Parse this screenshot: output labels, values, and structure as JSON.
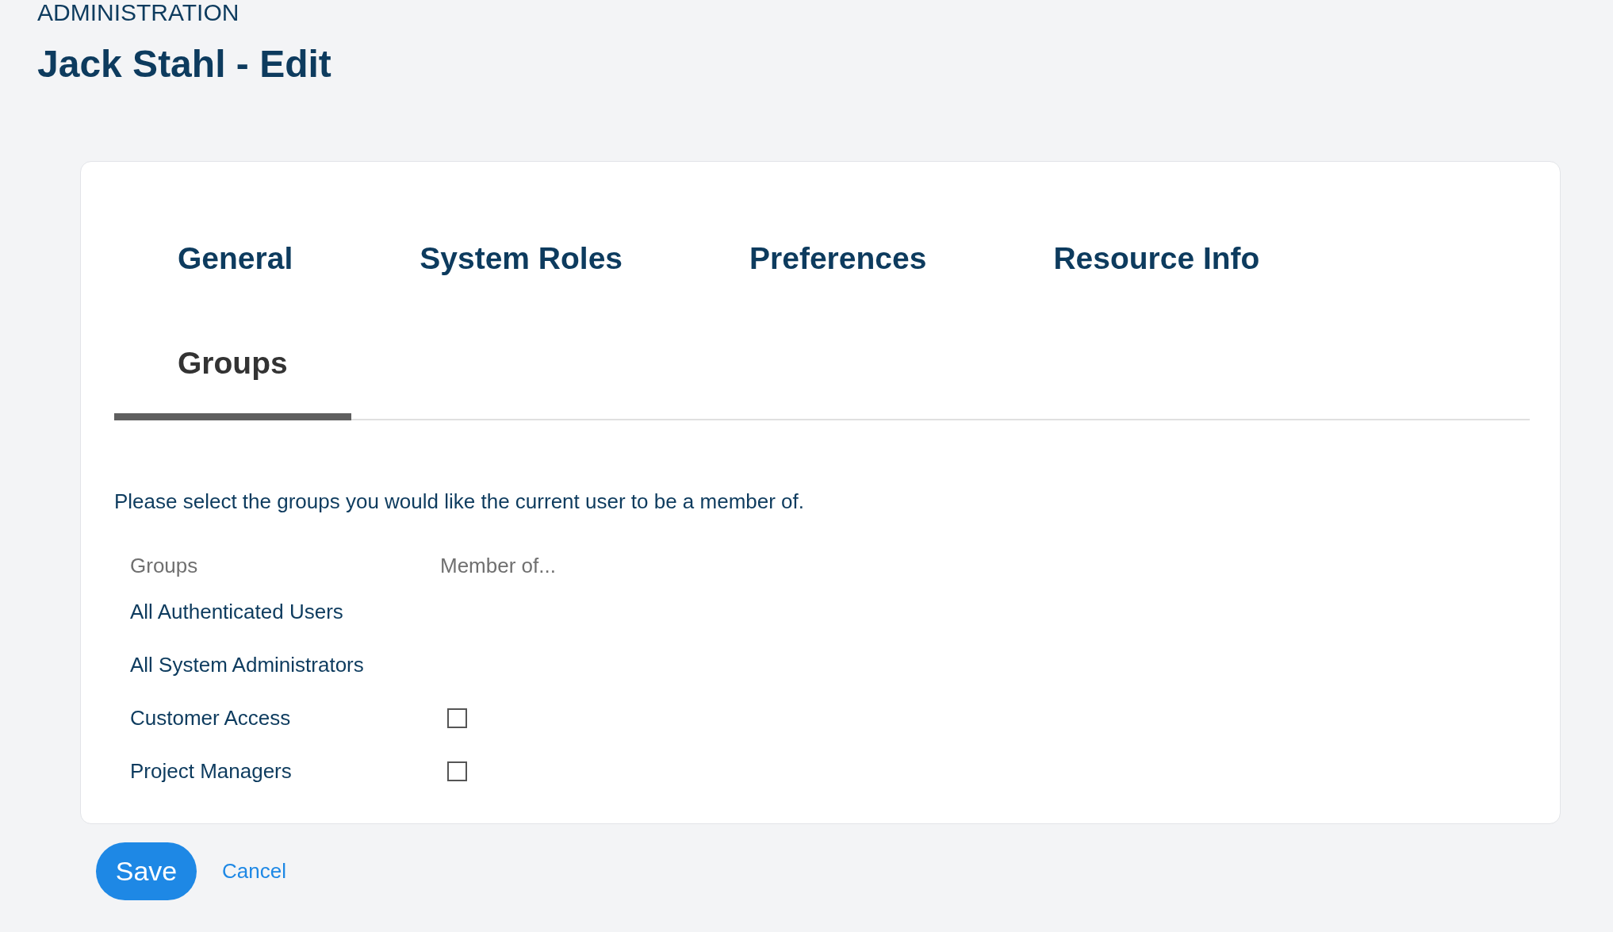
{
  "section": "ADMINISTRATION",
  "title": "Jack Stahl - Edit",
  "tabs": [
    {
      "label": "General",
      "selected": false
    },
    {
      "label": "System Roles",
      "selected": false
    },
    {
      "label": "Preferences",
      "selected": false
    },
    {
      "label": "Resource Info",
      "selected": false
    },
    {
      "label": "Groups",
      "selected": true
    }
  ],
  "instructions": "Please select the groups you would like the current user to be a member of.",
  "table": {
    "columns": [
      "Groups",
      "Member of..."
    ],
    "rows": [
      {
        "group": "All Authenticated Users",
        "kind": "fixed"
      },
      {
        "group": "All System Administrators",
        "kind": "fixed"
      },
      {
        "group": "Customer Access",
        "kind": "checkbox",
        "checked": false
      },
      {
        "group": "Project Managers",
        "kind": "checkbox",
        "checked": false
      }
    ]
  },
  "buttons": {
    "save": "Save",
    "cancel": "Cancel"
  }
}
